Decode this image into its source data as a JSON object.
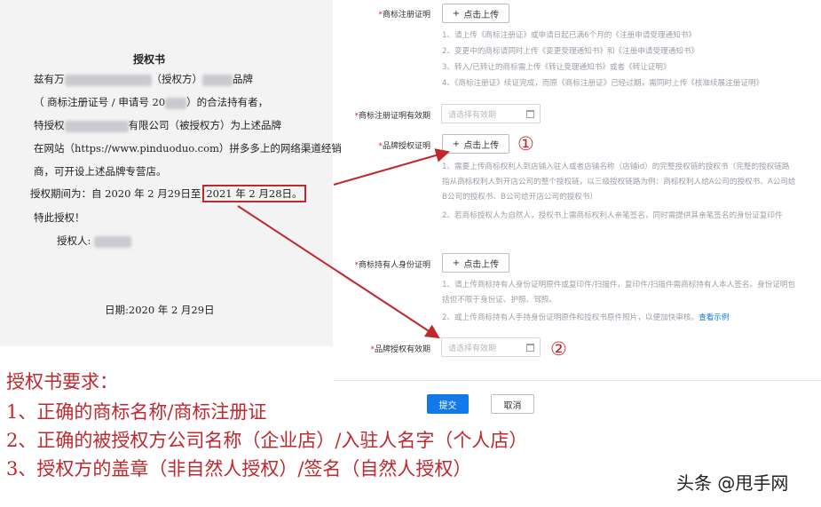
{
  "document": {
    "title": "授权书",
    "line1a": "兹有万",
    "line1b": "（授权方）",
    "line1c": "品牌",
    "line2a": "（ 商标注册证号 / 申请号 20",
    "line2b": "）的合法持有者，",
    "line3a": "特授权",
    "line3b": "有限公司",
    "line3c": "（被授权方）为上述品牌",
    "line4": "在网站（https://www.pinduoduo.com）拼多多上的网络渠道经销",
    "line5": "商，可开设上述品牌专营店。",
    "period_prefix": "授权期间为：自 2020 年 2 月29日至",
    "period_end": "2021 年 2 月28日。",
    "special": "特此授权！",
    "grantor": "授权人:",
    "date": "日期:2020 年 2 月29日"
  },
  "form": {
    "upload_label": "点击上传",
    "date_placeholder": "请选择有效期",
    "fields": {
      "tm_cert_label": "商标注册证明",
      "tm_cert_hints": [
        "1、请上传《商标注册证》或申请日起已满6个月的《注册申请受理通知书》",
        "2、变更中的商标请同时上传《变更受理通知书》和《注册申请受理通知书》",
        "3、转入/已转让的商标需上传《转让受理通知书》或者《转让证明》",
        "4、《商标注册证》续证完成，而原《商标注册证》已经过期，需同时上传《核准续展注册证明》"
      ],
      "tm_validity_label": "商标注册证明有效期",
      "brand_auth_label": "品牌授权证明",
      "brand_auth_hint1": "1、需要上传商标权利人到店铺入驻人或者店铺名称（店铺id）的完整授权链的授权书（完整的授权链路指从商标权利人到开店公司的整个授权链，以三级授权链路为例：商标权利人给A公司的授权书、A公司给B公司的授权书、B公司给开店公司的授权书）",
      "brand_auth_hint2": "2、若商标授权人为自然人，授权书上需商标权利人亲笔签名，同时需提供其亲笔签名的身份证复印件",
      "holder_id_label": "商标持有人身份证明",
      "holder_id_hint1": "1、请上传商标持有人身份证明原件或复印件/扫描件，复印件/扫描件需商标持有人本人签名。身份证明包括但不限于身份证、护照、驾照。",
      "holder_id_hint2_prefix": "2、或上传商标持有人手持身份证明原件和授权书原件照片，以便加快审核。",
      "holder_id_hint2_link": "查看示例",
      "auth_validity_label": "品牌授权有效期"
    },
    "submit": "提交",
    "cancel": "取消"
  },
  "markers": {
    "one": "①",
    "two": "②"
  },
  "requirements": {
    "title": "授权书要求：",
    "items": [
      "1、正确的商标名称/商标注册证",
      "2、正确的被授权方公司名称（企业店）/入驻人名字（个人店）",
      "3、授权方的盖章（非自然人授权）/签名（自然人授权）"
    ]
  },
  "watermark": "头条 @甩手网",
  "colors": {
    "annotation": "#c0282d",
    "primary": "#1479e8",
    "required": "#e6223d",
    "hint": "#9a9fa8"
  }
}
